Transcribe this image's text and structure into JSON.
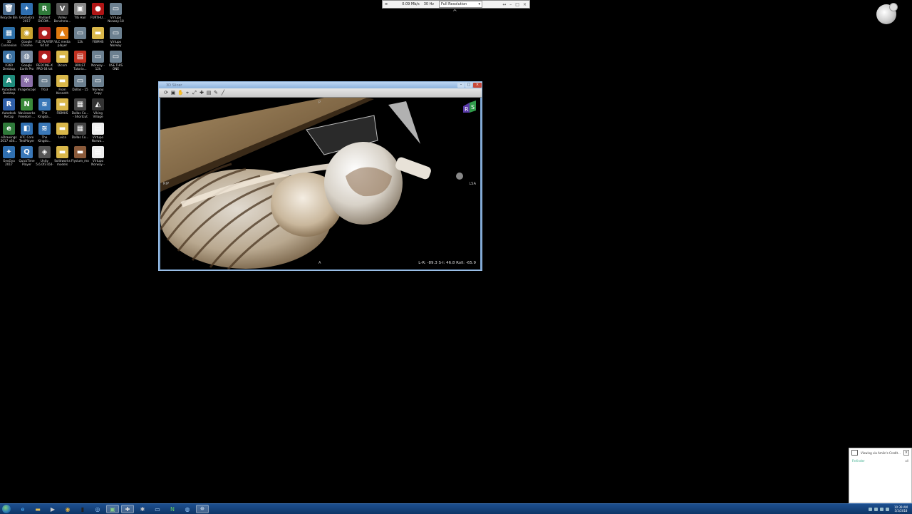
{
  "desktop": {
    "icons": [
      {
        "label": "Recycle Bin",
        "glyph": "🗑",
        "color": "#4a6a8a"
      },
      {
        "label": "GeoGebra 2017",
        "glyph": "✦",
        "color": "#2f6fb0"
      },
      {
        "label": "Radiant DICOM...",
        "glyph": "R",
        "color": "#2f7a3a"
      },
      {
        "label": "Valley Benchma...",
        "glyph": "V",
        "color": "#555"
      },
      {
        "label": "TIG Hair",
        "glyph": "▣",
        "color": "#888"
      },
      {
        "label": "FURTHU...",
        "glyph": "●",
        "color": "#b01515"
      },
      {
        "label": "Virtupo Norway-18",
        "glyph": "▭",
        "color": "#6c8090"
      },
      {
        "label": "3D Connexion Home",
        "glyph": "▦",
        "color": "#2d6fa8"
      },
      {
        "label": "Google Chrome",
        "glyph": "◉",
        "color": "#c9a230"
      },
      {
        "label": "FLD PLAYER 64 bit",
        "glyph": "●",
        "color": "#b02020"
      },
      {
        "label": "VLC media player",
        "glyph": "▲",
        "color": "#e07a10"
      },
      {
        "label": "12k",
        "glyph": "▭",
        "color": "#6c8090"
      },
      {
        "label": "FIBMHS",
        "glyph": "▬",
        "color": "#d9b74a"
      },
      {
        "label": "Virtupo Norway",
        "glyph": "▭",
        "color": "#6c8090"
      },
      {
        "label": "X360 Desktop",
        "glyph": "◐",
        "color": "#3a70a0"
      },
      {
        "label": "Google Earth Pro",
        "glyph": "◍",
        "color": "#7a8aa0"
      },
      {
        "label": "REDCINE-X PRO 64-bit",
        "glyph": "●",
        "color": "#b02020"
      },
      {
        "label": "Dicom",
        "glyph": "▬",
        "color": "#d9b74a"
      },
      {
        "label": "BRILST Tutorio...",
        "glyph": "▤",
        "color": "#c03020"
      },
      {
        "label": "Norway - 12k",
        "glyph": "▭",
        "color": "#6c8090"
      },
      {
        "label": "USE THIS ONE",
        "glyph": "▭",
        "color": "#6c8090"
      },
      {
        "label": "Autodesk Desktop App",
        "glyph": "A",
        "color": "#1f8c7c"
      },
      {
        "label": "ImageScope",
        "glyph": "✲",
        "color": "#8a6fa8"
      },
      {
        "label": "TIG3",
        "glyph": "▭",
        "color": "#6c8090"
      },
      {
        "label": "From Kenneth",
        "glyph": "▬",
        "color": "#d9b74a"
      },
      {
        "label": "Dallas - 15",
        "glyph": "▭",
        "color": "#6c8090"
      },
      {
        "label": "Norway Copy",
        "glyph": "▭",
        "color": "#6c8090"
      },
      {
        "label": "Autodesk ReCap",
        "glyph": "R",
        "color": "#2f5fa8"
      },
      {
        "label": "Navisworks Freedom ...",
        "glyph": "N",
        "color": "#3a8a3a"
      },
      {
        "label": "The Kingda...",
        "glyph": "≋",
        "color": "#3a78b8"
      },
      {
        "label": "FIBMHS",
        "glyph": "▬",
        "color": "#d9b74a"
      },
      {
        "label": "Dallas Co... - Shortcut",
        "glyph": "▦",
        "color": "#444"
      },
      {
        "label": "Viking Village Demo",
        "glyph": "◭",
        "color": "#333"
      },
      {
        "label": "eDrawings 2017 x64...",
        "glyph": "e",
        "color": "#2f7a3a"
      },
      {
        "label": "HTC Core TestPlayer",
        "glyph": "◧",
        "color": "#2f6fb0"
      },
      {
        "label": "The Kingdo...",
        "glyph": "≋",
        "color": "#3a78b8"
      },
      {
        "label": "Leica",
        "glyph": "▬",
        "color": "#d9b74a"
      },
      {
        "label": "Dallas Co...",
        "glyph": "▦",
        "color": "#444"
      },
      {
        "label": "Virtupo Norwa...",
        "glyph": "▤",
        "color": "#eee"
      },
      {
        "label": "GeoGya 2017",
        "glyph": "✦",
        "color": "#2f6fb0"
      },
      {
        "label": "QuickTime Player",
        "glyph": "Q",
        "color": "#3a78b8"
      },
      {
        "label": "Unity 5.6.0f3 (64-bit)",
        "glyph": "◈",
        "color": "#555"
      },
      {
        "label": "Solidworks models",
        "glyph": "▬",
        "color": "#d9b74a"
      },
      {
        "label": "Flysium_mo...",
        "glyph": "▬",
        "color": "#8a5a3a"
      },
      {
        "label": "Virtupo Norway - 12k",
        "glyph": "▤",
        "color": "#eee"
      }
    ]
  },
  "stream_bar": {
    "menu_icon": "≡",
    "bandwidth": "0.09 Mb/s",
    "refresh": "30 Hz",
    "quality_selected": "Full Resolution",
    "dropdown_icon": "▾",
    "controls": [
      "↔",
      "–",
      "□",
      "×"
    ],
    "caret": "^"
  },
  "app_window": {
    "title": "3D Slicer",
    "controls": [
      "–",
      "□",
      "×"
    ],
    "toolbar_icons": [
      "⟳",
      "▣",
      "✋",
      "⌖",
      "⤢",
      "✚",
      "▤",
      "✎",
      "╱"
    ],
    "viewport": {
      "orientation": {
        "top": "P",
        "left": "RIP",
        "right": "LSA",
        "bottom": "A"
      },
      "readout": "L-R: -89.3 S-I: 46.8 Roll: -65.9",
      "badge_letters": [
        "R",
        "S"
      ]
    }
  },
  "notification": {
    "title": "Viewing via Amlin's Credit...",
    "line_left": "Ferlinder",
    "line_right": "all"
  },
  "taskbar": {
    "items": [
      {
        "name": "ie",
        "glyph": "e",
        "color": "#4fb3ff",
        "active": false
      },
      {
        "name": "explorer",
        "glyph": "▬",
        "color": "#e5c05a",
        "active": false
      },
      {
        "name": "media",
        "glyph": "▶",
        "color": "#ccc",
        "active": false
      },
      {
        "name": "chrome",
        "glyph": "◉",
        "color": "#e0b040",
        "active": false
      },
      {
        "name": "cmd",
        "glyph": "▮",
        "color": "#222",
        "active": false
      },
      {
        "name": "remote",
        "glyph": "◎",
        "color": "#9cf",
        "active": false
      },
      {
        "name": "slicer",
        "glyph": "▣",
        "color": "#8c8",
        "active": true
      },
      {
        "name": "tool",
        "glyph": "✚",
        "color": "#ddd",
        "active": true
      },
      {
        "name": "gear",
        "glyph": "✱",
        "color": "#ccc",
        "active": false
      },
      {
        "name": "monitor",
        "glyph": "▭",
        "color": "#bdf",
        "active": false
      },
      {
        "name": "navis",
        "glyph": "N",
        "color": "#6c6",
        "active": false
      },
      {
        "name": "browser",
        "glyph": "◍",
        "color": "#9cf",
        "active": false
      },
      {
        "name": "connect",
        "glyph": "⛯",
        "color": "#cde",
        "active": true
      }
    ],
    "clock_time": "10:39 AM",
    "clock_date": "5/3/2018"
  }
}
